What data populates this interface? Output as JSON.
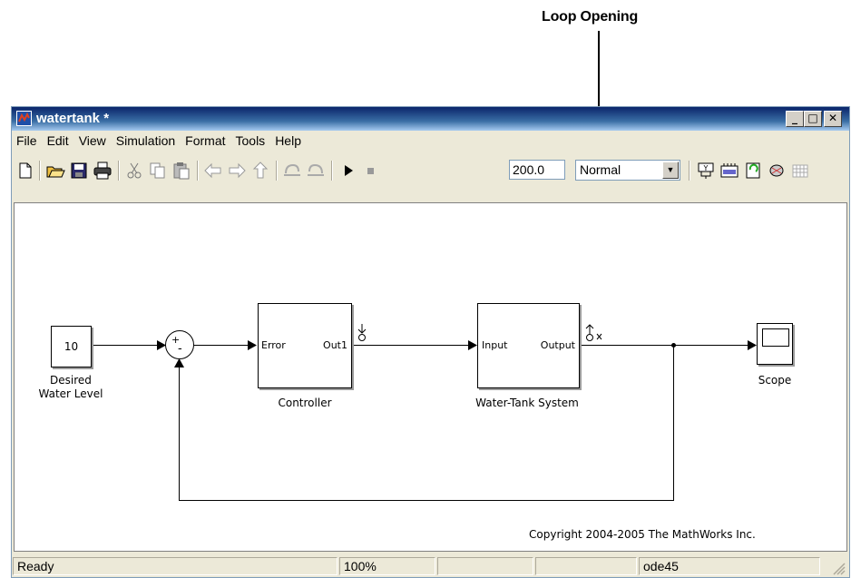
{
  "callout": {
    "label": "Loop Opening"
  },
  "window": {
    "title": "watertank *"
  },
  "menu": [
    "File",
    "Edit",
    "View",
    "Simulation",
    "Format",
    "Tools",
    "Help"
  ],
  "toolbar": {
    "stop_time": "200.0",
    "sim_mode": "Normal"
  },
  "diagram": {
    "constant_value": "10",
    "constant_label_line1": "Desired",
    "constant_label_line2": "Water Level",
    "sum_plus": "+",
    "sum_minus": "-",
    "controller": {
      "in_port": "Error",
      "out_port": "Out1",
      "label": "Controller"
    },
    "plant": {
      "in_port": "Input",
      "out_port": "Output",
      "label": "Water-Tank System"
    },
    "scope_label": "Scope",
    "copyright": "Copyright 2004-2005 The MathWorks Inc."
  },
  "status": {
    "state": "Ready",
    "zoom": "100%",
    "solver": "ode45"
  }
}
